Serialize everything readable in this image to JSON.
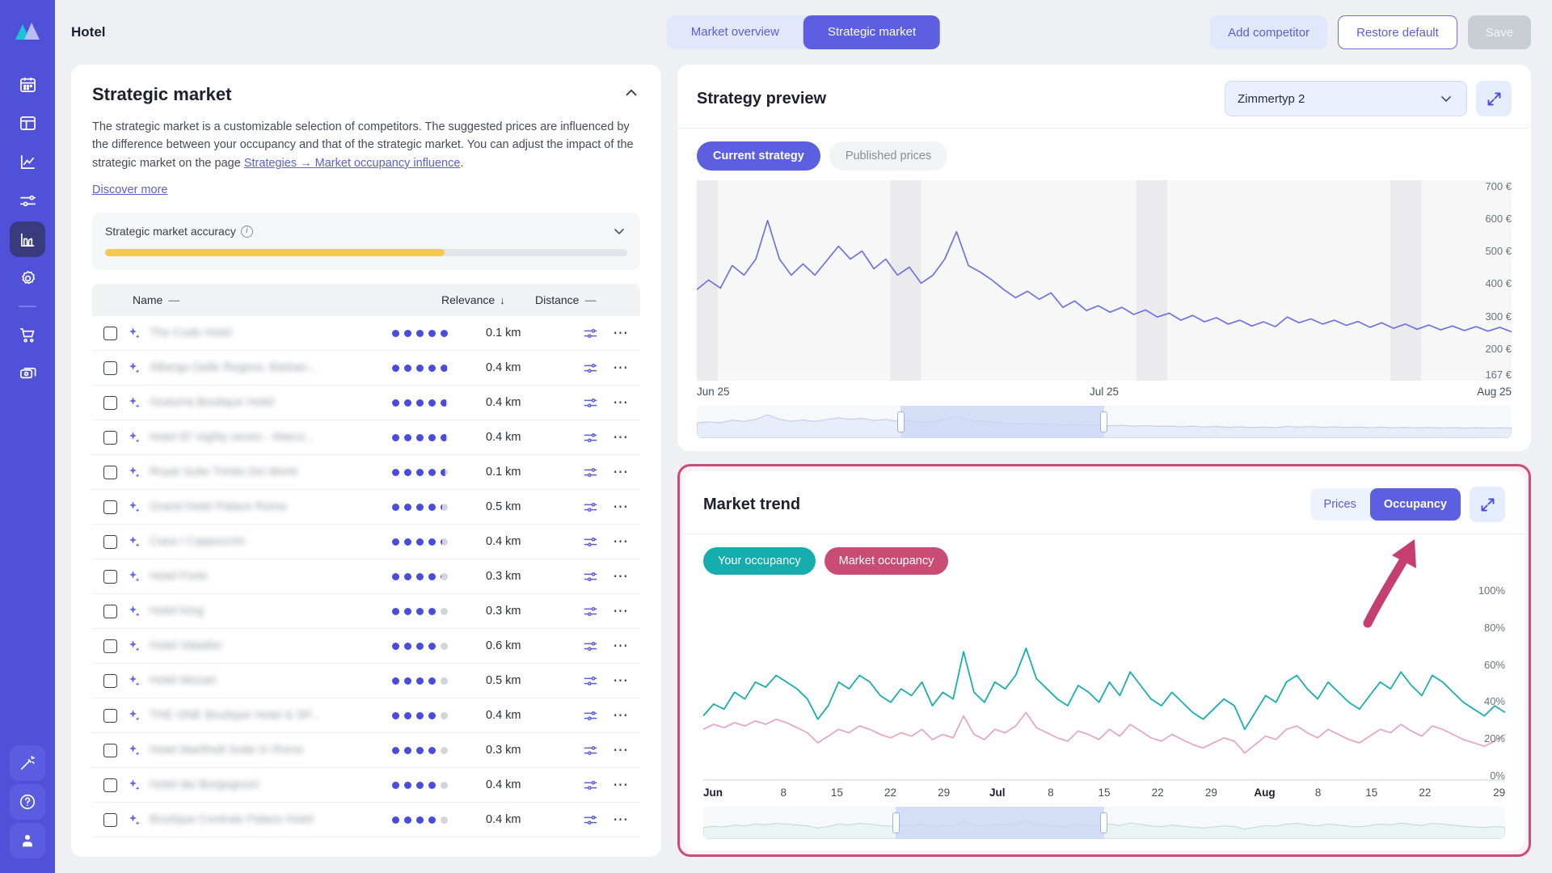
{
  "sidebar": {
    "logo_name": "app-logo",
    "items": [
      {
        "name": "calendar-icon",
        "label": "Calendar",
        "active": false
      },
      {
        "name": "dashboard-icon",
        "label": "Dashboard",
        "active": false
      },
      {
        "name": "analytics-chart-icon",
        "label": "Analytics",
        "active": false
      },
      {
        "name": "sliders-icon",
        "label": "Settings sliders",
        "active": false
      },
      {
        "name": "market-chart-icon",
        "label": "Market",
        "active": true
      },
      {
        "name": "gear-icon",
        "label": "Settings",
        "active": false
      },
      {
        "name": "cart-icon",
        "label": "Shop",
        "active": false
      },
      {
        "name": "money-icon",
        "label": "Billing",
        "active": false
      }
    ],
    "bottom_items": [
      {
        "name": "magic-wand-icon",
        "label": "Assistant"
      },
      {
        "name": "help-circle-icon",
        "label": "Help"
      },
      {
        "name": "user-account-icon",
        "label": "Account"
      }
    ]
  },
  "topbar": {
    "title": "Hotel",
    "tabs": [
      {
        "label": "Market overview",
        "active": false
      },
      {
        "label": "Strategic market",
        "active": true
      }
    ],
    "add_competitor_label": "Add competitor",
    "restore_default_label": "Restore default",
    "save_label": "Save"
  },
  "strategic_market": {
    "title": "Strategic market",
    "description_part1": "The strategic market is a customizable selection of competitors. The suggested prices are influenced by the difference between your occupancy and that of the strategic market. You can adjust the impact of the strategic market on the page ",
    "link_text": "Strategies → Market occupancy influence",
    "description_part2": ".",
    "discover_more": "Discover more",
    "accuracy_label": "Strategic market accuracy",
    "accuracy_percent": 65,
    "accuracy_color": "#f5c755",
    "columns": {
      "name": "Name",
      "relevance": "Relevance",
      "distance": "Distance"
    },
    "sort_indicator": "↓",
    "neutral_indicator": "—",
    "rows": [
      {
        "name": "The Code Hotel",
        "relevance": 5.0,
        "distance": "0.1 km"
      },
      {
        "name": "Albergo Delle Regioni, Barbari...",
        "relevance": 4.9,
        "distance": "0.4 km"
      },
      {
        "name": "Giulurria Boutique Hotel",
        "relevance": 4.8,
        "distance": "0.4 km"
      },
      {
        "name": "Hotel 87 eighty seven - Marco...",
        "relevance": 4.8,
        "distance": "0.4 km"
      },
      {
        "name": "Royal Suite Trinita Dei Monti",
        "relevance": 4.6,
        "distance": "0.1 km"
      },
      {
        "name": "Grand Hotel Palace Roma",
        "relevance": 4.2,
        "distance": "0.5 km"
      },
      {
        "name": "Casa I Cappuccini",
        "relevance": 4.2,
        "distance": "0.4 km"
      },
      {
        "name": "Hotel Forte",
        "relevance": 4.1,
        "distance": "0.3 km"
      },
      {
        "name": "Hotel King",
        "relevance": 4.0,
        "distance": "0.3 km"
      },
      {
        "name": "Hotel Valadier",
        "relevance": 4.0,
        "distance": "0.6 km"
      },
      {
        "name": "Hotel Mozart",
        "relevance": 4.0,
        "distance": "0.5 km"
      },
      {
        "name": "THE ONE Boutique Hotel & SP...",
        "relevance": 4.0,
        "distance": "0.4 km"
      },
      {
        "name": "Hotel Manfredi Suite In Rome",
        "relevance": 4.0,
        "distance": "0.3 km"
      },
      {
        "name": "Hotel dei Borgognoni",
        "relevance": 4.0,
        "distance": "0.4 km"
      },
      {
        "name": "Boutique Centrale Palace Hotel",
        "relevance": 4.0,
        "distance": "0.4 km"
      }
    ]
  },
  "strategy_preview": {
    "title": "Strategy preview",
    "room_type_selected": "Zimmertyp 2",
    "expand_icon": "expand-diagonal-icon",
    "tabs": [
      {
        "label": "Current strategy",
        "active": true
      },
      {
        "label": "Published prices",
        "active": false
      }
    ]
  },
  "market_trend": {
    "title": "Market trend",
    "view_tabs": [
      {
        "label": "Prices",
        "active": false
      },
      {
        "label": "Occupancy",
        "active": true
      }
    ],
    "expand_icon": "expand-diagonal-icon",
    "legend": [
      {
        "label": "Your occupancy",
        "color": "#16adae"
      },
      {
        "label": "Market occupancy",
        "color": "#c94c75"
      }
    ],
    "highlight_border_color": "#d14a77",
    "annotation_arrow_color": "#c43e6e"
  },
  "chart_data": [
    {
      "type": "line",
      "id": "strategy-preview-chart",
      "title": "Strategy preview",
      "xlabel": "",
      "ylabel": "",
      "ylim": [
        167,
        700
      ],
      "ytick_labels": [
        "700 €",
        "600 €",
        "500 €",
        "400 €",
        "300 €",
        "200 €",
        "167 €"
      ],
      "ytick_values": [
        700,
        600,
        500,
        400,
        300,
        200,
        167
      ],
      "xtick_labels": [
        "Jun 25",
        "Jul 25",
        "Aug 25"
      ],
      "grid": false,
      "legend_position": "none",
      "series": [
        {
          "name": "Current strategy",
          "color": "#6f73e0",
          "values": [
            425,
            455,
            430,
            500,
            470,
            520,
            640,
            520,
            470,
            505,
            470,
            515,
            560,
            520,
            545,
            490,
            520,
            470,
            495,
            445,
            470,
            520,
            605,
            500,
            480,
            455,
            425,
            400,
            420,
            395,
            415,
            370,
            390,
            360,
            375,
            355,
            370,
            348,
            362,
            340,
            352,
            330,
            345,
            325,
            338,
            318,
            330,
            312,
            325,
            310,
            340,
            322,
            334,
            318,
            330,
            314,
            326,
            308,
            322,
            305,
            318,
            302,
            315,
            300,
            312,
            298,
            310,
            296,
            308,
            294
          ]
        }
      ],
      "range_selector": {
        "start_pct": 25,
        "end_pct": 50
      }
    },
    {
      "type": "line",
      "id": "market-trend-chart",
      "title": "Market trend",
      "xlabel": "",
      "ylabel": "",
      "ylim": [
        0,
        100
      ],
      "ytick_labels": [
        "100%",
        "80%",
        "60%",
        "40%",
        "20%",
        "0%"
      ],
      "ytick_values": [
        100,
        80,
        60,
        40,
        20,
        0
      ],
      "xtick_labels": [
        "Jun",
        "8",
        "15",
        "22",
        "29",
        "Jul",
        "8",
        "15",
        "22",
        "29",
        "Aug",
        "8",
        "15",
        "22",
        "29"
      ],
      "grid": false,
      "legend_position": "top-left",
      "series": [
        {
          "name": "Your occupancy",
          "color": "#16adae",
          "values": [
            38,
            45,
            42,
            52,
            48,
            58,
            55,
            62,
            58,
            54,
            48,
            36,
            44,
            58,
            54,
            62,
            58,
            50,
            46,
            54,
            50,
            58,
            44,
            52,
            48,
            76,
            52,
            46,
            58,
            54,
            62,
            78,
            60,
            54,
            48,
            44,
            56,
            52,
            46,
            58,
            50,
            64,
            56,
            48,
            44,
            52,
            46,
            40,
            36,
            42,
            48,
            44,
            30,
            40,
            50,
            46,
            58,
            62,
            54,
            48,
            58,
            52,
            46,
            42,
            50,
            58,
            54,
            64,
            56,
            50,
            62,
            58,
            52,
            46,
            42,
            38,
            44,
            40
          ]
        },
        {
          "name": "Market occupancy",
          "color": "#e6a8bc",
          "values": [
            30,
            33,
            31,
            34,
            32,
            35,
            33,
            36,
            34,
            31,
            28,
            22,
            26,
            30,
            28,
            32,
            30,
            27,
            25,
            28,
            26,
            30,
            24,
            27,
            25,
            38,
            27,
            24,
            30,
            28,
            32,
            40,
            31,
            28,
            25,
            23,
            29,
            27,
            24,
            30,
            26,
            33,
            29,
            25,
            23,
            27,
            24,
            21,
            19,
            22,
            25,
            23,
            16,
            21,
            26,
            24,
            30,
            32,
            28,
            25,
            30,
            27,
            24,
            22,
            26,
            30,
            28,
            33,
            29,
            26,
            32,
            30,
            27,
            24,
            22,
            20,
            23,
            27
          ]
        }
      ],
      "range_selector": {
        "start_pct": 24,
        "end_pct": 50
      }
    }
  ]
}
